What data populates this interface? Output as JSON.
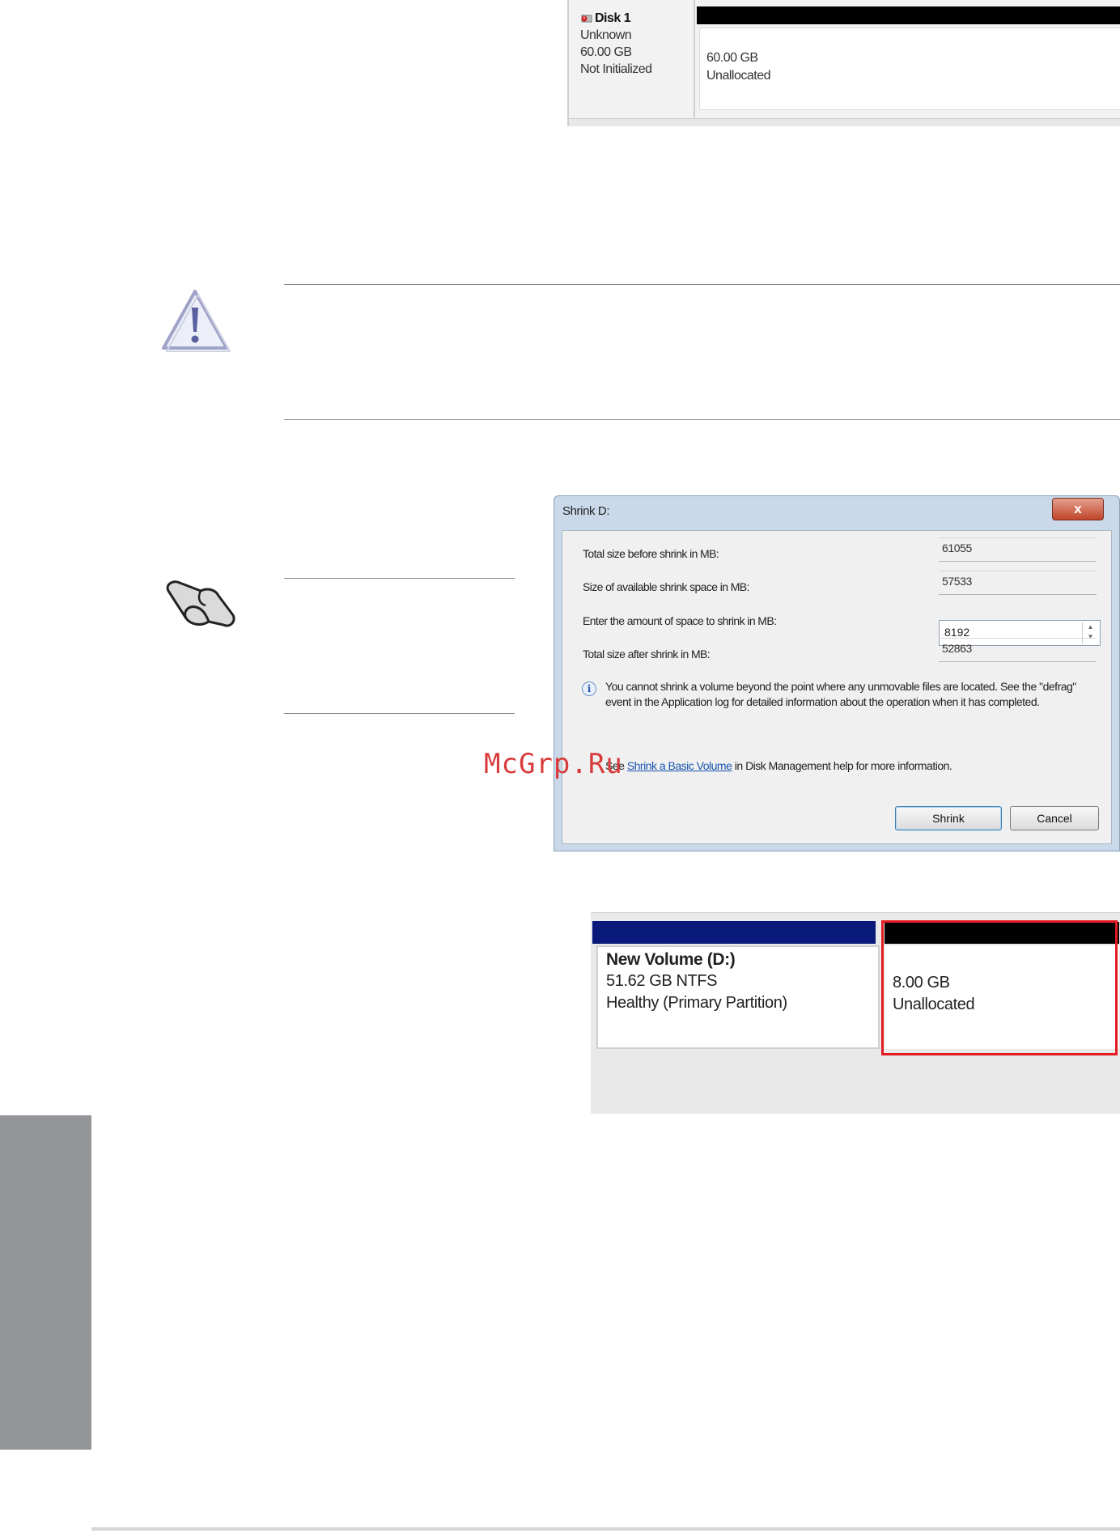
{
  "disk1": {
    "name": "Disk 1",
    "type": "Unknown",
    "size": "60.00 GB",
    "status": "Not Initialized",
    "partition_size": "60.00 GB",
    "partition_state": "Unallocated"
  },
  "shrink_dialog": {
    "title": "Shrink D:",
    "close_label": "x",
    "total_before_label": "Total size before shrink in MB:",
    "total_before_value": "61055",
    "available_label": "Size of available shrink space in MB:",
    "available_value": "57533",
    "amount_label": "Enter the amount of space to shrink in MB:",
    "amount_value": "8192",
    "total_after_label": "Total size after shrink in MB:",
    "total_after_value": "52863",
    "info_text": "You cannot shrink a volume beyond the point where any unmovable files are located. See the \"defrag\" event in the Application log for detailed information about the operation when it has completed.",
    "help_prefix": "See",
    "help_link": "Shrink a Basic Volume",
    "help_suffix": "in Disk Management help for more information.",
    "shrink_button": "Shrink",
    "cancel_button": "Cancel"
  },
  "watermark": "McGrp.Ru",
  "new_volume": {
    "name": "New Volume  (D:)",
    "size_fs": "51.62 GB NTFS",
    "status": "Healthy (Primary Partition)",
    "unallocated_size": "8.00 GB",
    "unallocated_label": "Unallocated"
  },
  "colors": {
    "highlight": "#e31b23",
    "side_tab": "#949599",
    "volume_bar": "#0a1a7a"
  }
}
